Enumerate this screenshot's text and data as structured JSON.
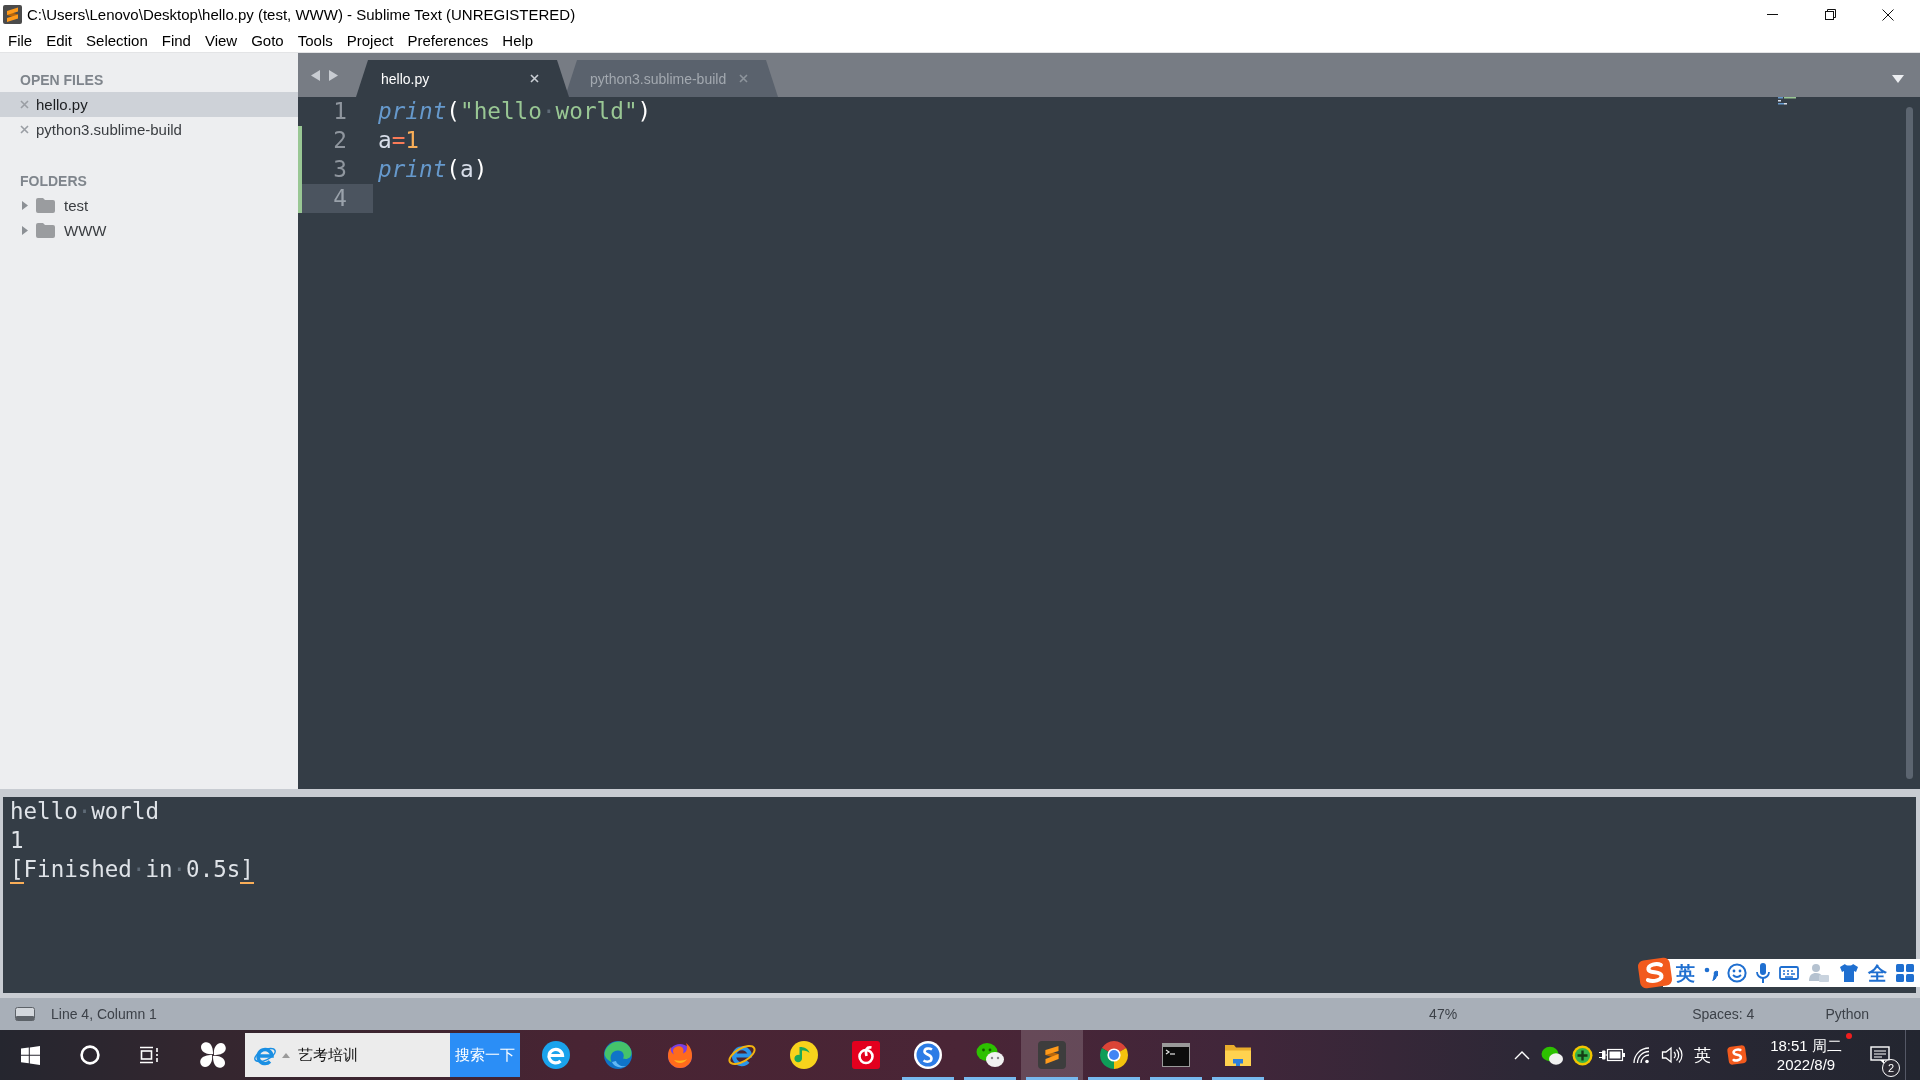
{
  "window": {
    "title": "C:\\Users\\Lenovo\\Desktop\\hello.py (test, WWW) - Sublime Text (UNREGISTERED)"
  },
  "menu": [
    "File",
    "Edit",
    "Selection",
    "Find",
    "View",
    "Goto",
    "Tools",
    "Project",
    "Preferences",
    "Help"
  ],
  "sidebar": {
    "open_files": {
      "heading": "OPEN FILES",
      "items": [
        {
          "label": "hello.py",
          "selected": true
        },
        {
          "label": "python3.sublime-build",
          "selected": false
        }
      ]
    },
    "folders": {
      "heading": "FOLDERS",
      "items": [
        {
          "label": "test",
          "expanded": false
        },
        {
          "label": "WWW",
          "expanded": false
        }
      ]
    }
  },
  "tabs": [
    {
      "label": "hello.py",
      "selected": true
    },
    {
      "label": "python3.sublime-build",
      "selected": false
    }
  ],
  "editor": {
    "lines": [
      {
        "number": "1",
        "current": false,
        "modified": false,
        "tokens": [
          {
            "kind": "function",
            "text": "print"
          },
          {
            "kind": "punct",
            "text": "("
          },
          {
            "kind": "string",
            "text": "\"hello"
          },
          {
            "kind": "space",
            "text": "·"
          },
          {
            "kind": "string",
            "text": "world\""
          },
          {
            "kind": "punct",
            "text": ")"
          }
        ]
      },
      {
        "number": "2",
        "current": false,
        "modified": true,
        "tokens": [
          {
            "kind": "ident",
            "text": "a"
          },
          {
            "kind": "operator",
            "text": "="
          },
          {
            "kind": "number",
            "text": "1"
          }
        ]
      },
      {
        "number": "3",
        "current": false,
        "modified": true,
        "tokens": [
          {
            "kind": "function",
            "text": "print"
          },
          {
            "kind": "punct",
            "text": "("
          },
          {
            "kind": "ident",
            "text": "a"
          },
          {
            "kind": "punct",
            "text": ")"
          }
        ]
      },
      {
        "number": "4",
        "current": true,
        "modified": true
      }
    ]
  },
  "output": {
    "lines": [
      {
        "tokens": [
          {
            "kind": "plain",
            "text": "hello"
          },
          {
            "kind": "space",
            "text": "·"
          },
          {
            "kind": "plain",
            "text": "world"
          }
        ]
      },
      {
        "tokens": [
          {
            "kind": "plain",
            "text": "1"
          }
        ]
      },
      {
        "tokens": [
          {
            "kind": "bracket",
            "text": "["
          },
          {
            "kind": "plain",
            "text": "Finished"
          },
          {
            "kind": "space",
            "text": "·"
          },
          {
            "kind": "plain",
            "text": "in"
          },
          {
            "kind": "space",
            "text": "·"
          },
          {
            "kind": "plain",
            "text": "0.5s"
          },
          {
            "kind": "bracket",
            "text": "]"
          }
        ]
      }
    ]
  },
  "ime_toolbar": {
    "mode": "英",
    "width": "全"
  },
  "status_bar": {
    "position": "Line 4, Column 1",
    "percent": "47%",
    "indentation": "Spaces: 4",
    "syntax": "Python"
  },
  "taskbar": {
    "search": {
      "value": "艺考培训",
      "button": "搜索一下"
    },
    "apps": [
      {
        "kind": "ebadge",
        "running": false,
        "selected": false
      },
      {
        "kind": "wave",
        "running": false,
        "selected": false
      },
      {
        "kind": "fox",
        "running": false,
        "selected": false
      },
      {
        "kind": "eorbit",
        "running": false,
        "selected": false
      },
      {
        "kind": "note",
        "running": false,
        "selected": false
      },
      {
        "kind": "disc",
        "running": false,
        "selected": false
      },
      {
        "kind": "sbadge",
        "running": true,
        "selected": false
      },
      {
        "kind": "bubbles",
        "running": true,
        "selected": false
      },
      {
        "kind": "editor",
        "running": true,
        "selected": true
      },
      {
        "kind": "segments",
        "running": true,
        "selected": false
      },
      {
        "kind": "terminal",
        "running": true,
        "selected": false
      },
      {
        "kind": "folder",
        "running": true,
        "selected": false
      }
    ]
  },
  "tray": {
    "language": "英",
    "time": "18:51 周二",
    "date": "2022/8/9",
    "notifications": "2"
  }
}
